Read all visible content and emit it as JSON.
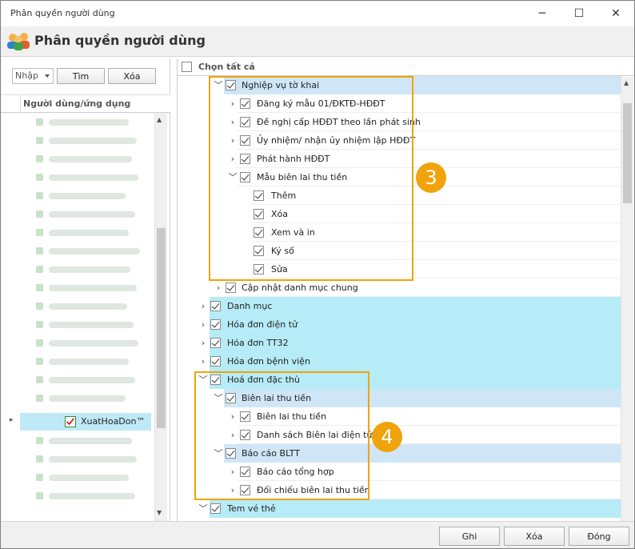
{
  "window": {
    "title": "Phân quyền người dùng"
  },
  "header": {
    "title": "Phân quyền người dùng"
  },
  "left": {
    "combo_value": "Nhập",
    "search_label": "Tìm",
    "delete_label": "Xóa",
    "column_header": "Người dùng/ứng dụng",
    "selected_user": "XuatHoaDon™"
  },
  "right": {
    "select_all": "Chọn tất cả",
    "rows": [
      "Nghiệp vụ tờ khai",
      "Đăng ký mẫu 01/ĐKTĐ-HĐĐT",
      "Đề nghị cấp HĐĐT theo lần phát sinh",
      "Ủy nhiệm/ nhận ủy nhiệm lập HĐĐT",
      "Phát hành HĐĐT",
      "Mẫu biên lai thu tiền",
      "Thêm",
      "Xóa",
      "Xem và in",
      "Ký số",
      "Sửa",
      "Cập nhật danh mục chung",
      "Danh mục",
      "Hóa đơn điện tử",
      "Hóa đơn TT32",
      "Hóa đơn bệnh viện",
      "Hoá đơn đặc thù",
      "Biên lai thu tiền",
      "Biên lai thu tiền",
      "Danh sách Biên lai điện tử",
      "Báo cáo BLTT",
      "Báo cáo tổng hợp",
      "Đối chiếu biên lai thu tiền",
      "Tem vé thẻ"
    ]
  },
  "callouts": {
    "three": "3",
    "four": "4"
  },
  "footer": {
    "save": "Ghi",
    "delete": "Xóa",
    "close": "Đóng"
  },
  "colors": {
    "cyan_row": "#b6ecf7",
    "blue_row": "#cfe6f7",
    "orange": "#f0a30a"
  }
}
